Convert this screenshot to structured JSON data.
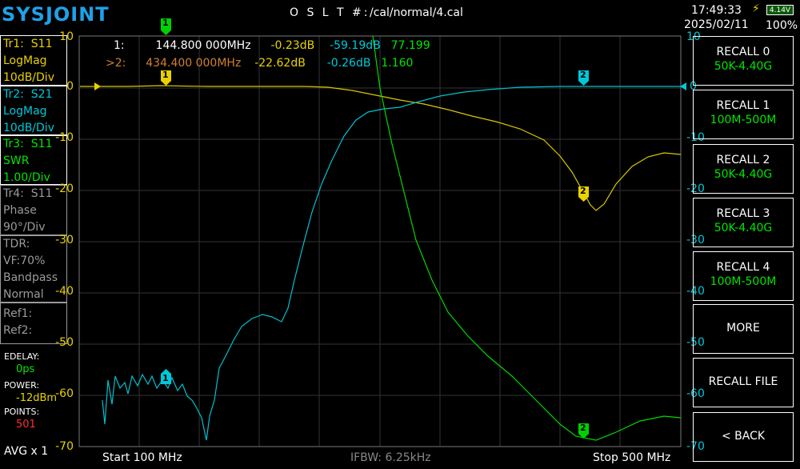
{
  "brand": "SYSJOINT",
  "header": {
    "cal_label": "O S L T #:",
    "cal_path": "/cal/normal/4.cal",
    "time": "17:49:33",
    "date": "2025/02/11",
    "battery_voltage": "4.14V",
    "battery_percent": "100%"
  },
  "traces": [
    {
      "id": "Tr1:",
      "param": "S11",
      "format": "LogMag",
      "scale": "10dB/Div",
      "color": "#e8d200"
    },
    {
      "id": "Tr2:",
      "param": "S21",
      "format": "LogMag",
      "scale": "10dB/Div",
      "color": "#00c8d8"
    },
    {
      "id": "Tr3:",
      "param": "S11",
      "format": "SWR",
      "scale": "1.00/Div",
      "color": "#00e600"
    },
    {
      "id": "Tr4:",
      "param": "S11",
      "format": "Phase",
      "scale": "90°/Div",
      "color": "#9a9a9a"
    }
  ],
  "tdr": {
    "title": "TDR:",
    "vf": "VF:70%",
    "mode": "Bandpass",
    "window": "Normal"
  },
  "refs": [
    "Ref1:",
    "Ref2:"
  ],
  "side": {
    "edelay_label": "EDELAY:",
    "edelay_value": "0ps",
    "power_label": "POWER:",
    "power_value": "-12dBm",
    "points_label": "POINTS:",
    "points_value": "501",
    "avg": "AVG x 1"
  },
  "markers": [
    {
      "label": "1:",
      "freq": "144.800 000MHz",
      "s11": "-0.23dB",
      "s21": "-59.19dB",
      "swr": "77.199"
    },
    {
      "label": ">2:",
      "freq": "434.400 000MHz",
      "s11": "-22.62dB",
      "s21": "-0.26dB",
      "swr": "1.160"
    }
  ],
  "axis": {
    "left_ticks": [
      "10",
      "0",
      "-10",
      "-20",
      "-30",
      "-40",
      "-50",
      "-60",
      "-70"
    ],
    "right_ticks": [
      "10",
      "0",
      "-10",
      "-20",
      "-30",
      "-40",
      "-50",
      "-60",
      "-70"
    ]
  },
  "footer": {
    "start": "Start  100 MHz",
    "ifbw": "IFBW: 6.25kHz",
    "stop": "Stop  500 MHz"
  },
  "buttons": [
    {
      "label": "RECALL 0",
      "sub": "50K-4.40G"
    },
    {
      "label": "RECALL 1",
      "sub": "100M-500M"
    },
    {
      "label": "RECALL 2",
      "sub": "50K-4.40G"
    },
    {
      "label": "RECALL 3",
      "sub": "50K-4.40G"
    },
    {
      "label": "RECALL 4",
      "sub": "100M-500M"
    },
    {
      "label": "MORE",
      "sub": ""
    },
    {
      "label": "RECALL FILE",
      "sub": ""
    },
    {
      "label": "< BACK",
      "sub": ""
    }
  ],
  "marker_flags": {
    "m1": "1",
    "m2": "2"
  }
}
